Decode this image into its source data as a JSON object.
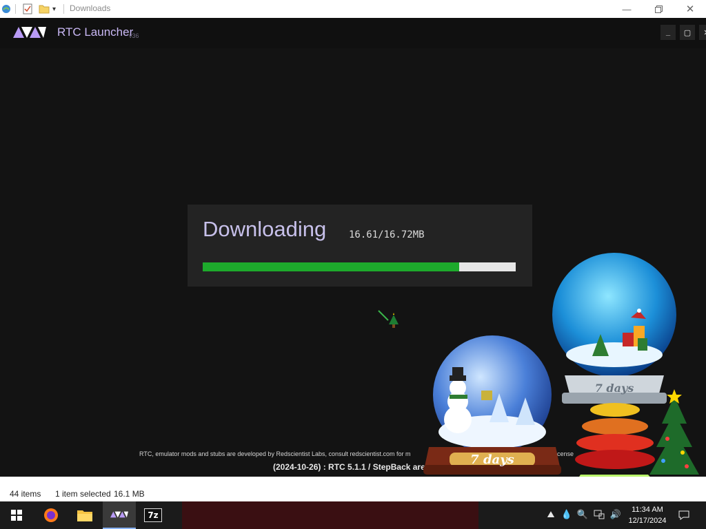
{
  "explorer": {
    "title": "Downloads",
    "minimize_icon": "minimize-icon",
    "restore_icon": "restore-icon",
    "close_icon": "close-icon"
  },
  "launcher": {
    "title": "RTC Launcher",
    "version": "v36",
    "buttons": {
      "minimize": "_",
      "maximize": "▢",
      "close": "✕"
    },
    "download": {
      "heading": "Downloading",
      "size": "16.61/16.72MB",
      "progress": 0.82
    },
    "footer": {
      "line1": "RTC, emulator mods and stubs are developed by Redscientist Labs, consult redscientist.com for m",
      "line1_tail": "license",
      "line2": "(2024-10-26) : RTC 5.1.1 / StepBack are rele"
    }
  },
  "statusbar": {
    "items_count": "44 items",
    "selection": "1 item selected",
    "selection_size": "16.1 MB"
  },
  "taskbar": {
    "apps": [
      "windows-start",
      "firefox",
      "file-explorer",
      "rtc-launcher",
      "7-zip"
    ],
    "sevenzip_label": "7z",
    "time": "11:34 AM",
    "date": "12/17/2024"
  },
  "decorations": {
    "globe_days_label": "7 days",
    "colors": {
      "accent": "#c9b8f5",
      "progress": "#1daa2c",
      "panel": "#232323"
    }
  }
}
